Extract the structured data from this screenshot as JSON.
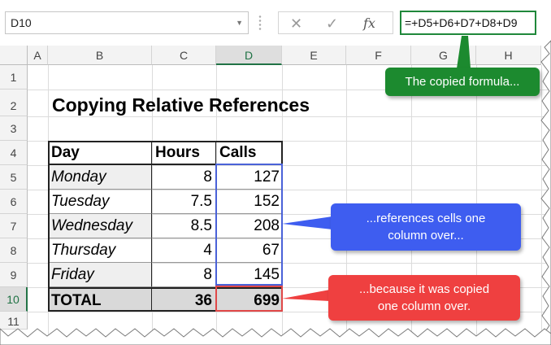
{
  "formula_bar": {
    "name_box": "D10",
    "cancel_glyph": "✕",
    "enter_glyph": "✓",
    "fx_label": "fx",
    "formula": "=+D5+D6+D7+D8+D9"
  },
  "columns": [
    "A",
    "B",
    "C",
    "D",
    "E",
    "F",
    "G",
    "H"
  ],
  "rows": [
    "1",
    "2",
    "3",
    "4",
    "5",
    "6",
    "7",
    "8",
    "9",
    "10",
    "11"
  ],
  "title": "Copying Relative References",
  "table": {
    "headers": [
      "Day",
      "Hours",
      "Calls"
    ],
    "rows": [
      {
        "day": "Monday",
        "hours": "8",
        "calls": "127"
      },
      {
        "day": "Tuesday",
        "hours": "7.5",
        "calls": "152"
      },
      {
        "day": "Wednesday",
        "hours": "8.5",
        "calls": "208"
      },
      {
        "day": "Thursday",
        "hours": "4",
        "calls": "67"
      },
      {
        "day": "Friday",
        "hours": "8",
        "calls": "145"
      }
    ],
    "total": {
      "label": "TOTAL",
      "hours": "36",
      "calls": "699"
    }
  },
  "callouts": {
    "green": "The copied formula...",
    "blue_line1": "...references cells one",
    "blue_line2": "column over...",
    "red_line1": "...because it was copied",
    "red_line2": "one column over."
  },
  "colors": {
    "green": "#1c8a2f",
    "blue": "#3e5df0",
    "red": "#ef4040",
    "selection": "#217346"
  }
}
